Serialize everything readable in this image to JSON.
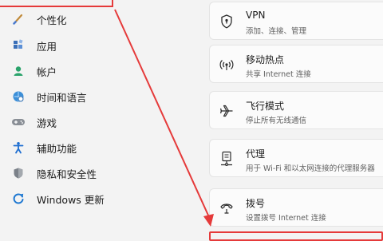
{
  "sidebar": {
    "items": [
      {
        "label": "个性化",
        "icon": "brush-icon"
      },
      {
        "label": "应用",
        "icon": "apps-icon"
      },
      {
        "label": "帐户",
        "icon": "account-icon"
      },
      {
        "label": "时间和语言",
        "icon": "globe-clock-icon"
      },
      {
        "label": "游戏",
        "icon": "gamepad-icon"
      },
      {
        "label": "辅助功能",
        "icon": "accessibility-icon"
      },
      {
        "label": "隐私和安全性",
        "icon": "shield-icon"
      },
      {
        "label": "Windows 更新",
        "icon": "windows-update-icon"
      }
    ]
  },
  "main": {
    "cards": [
      {
        "title": "VPN",
        "desc": "添加、连接、管理",
        "icon": "vpn-shield-icon"
      },
      {
        "title": "移动热点",
        "desc": "共享 Internet 连接",
        "icon": "hotspot-icon"
      },
      {
        "title": "飞行模式",
        "desc": "停止所有无线通信",
        "icon": "airplane-icon"
      },
      {
        "title": "代理",
        "desc": "用于 Wi-Fi 和以太网连接的代理服务器",
        "icon": "proxy-icon"
      },
      {
        "title": "拨号",
        "desc": "设置拨号 Internet 连接",
        "icon": "dialup-icon"
      }
    ]
  },
  "colors": {
    "annotation_red": "#e53a3a",
    "accent_blue": "#0067c0"
  }
}
